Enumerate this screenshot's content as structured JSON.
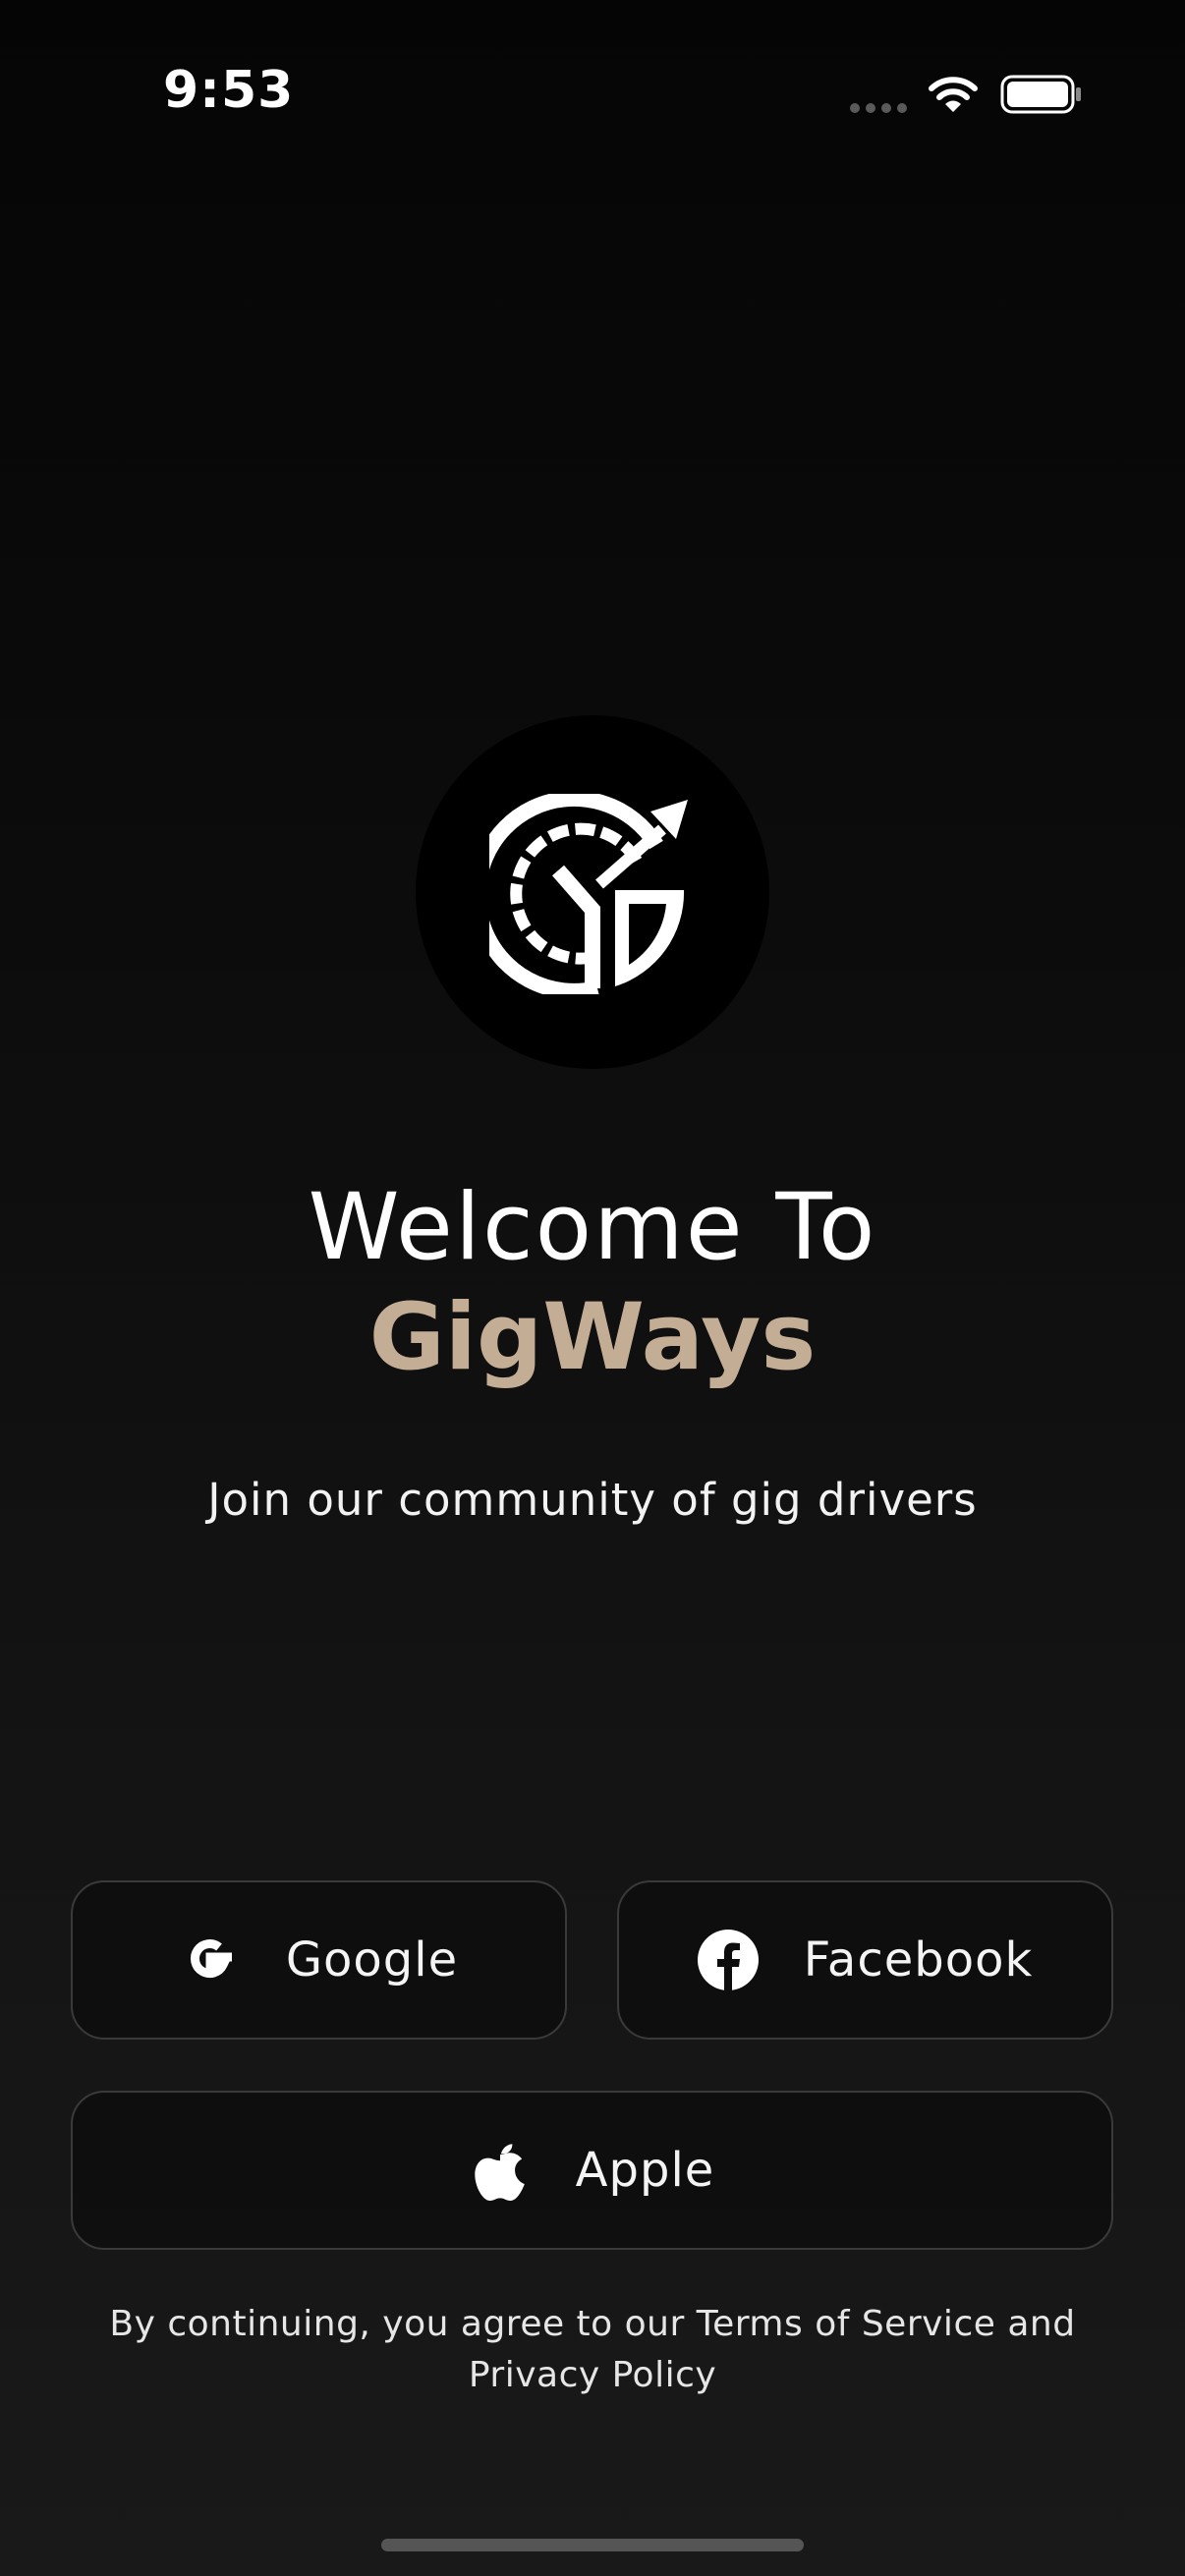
{
  "status_bar": {
    "time": "9:53"
  },
  "welcome": {
    "title": "Welcome To",
    "brand": "GigWays",
    "tagline": "Join our community of gig drivers"
  },
  "auth": {
    "google_label": "Google",
    "facebook_label": "Facebook",
    "apple_label": "Apple"
  },
  "legal": {
    "line1": "By continuing, you agree to our Terms of Service and",
    "line2": "Privacy Policy"
  },
  "icons": {
    "logo": "gigways-logo-icon",
    "google": "google-icon",
    "facebook": "facebook-icon",
    "apple": "apple-icon",
    "wifi": "wifi-icon",
    "battery": "battery-icon",
    "signal": "signal-dots-icon"
  },
  "colors": {
    "brand_accent": "#c4ad95",
    "background": "#0c0c0c",
    "button_border": "#3a3a3a"
  }
}
